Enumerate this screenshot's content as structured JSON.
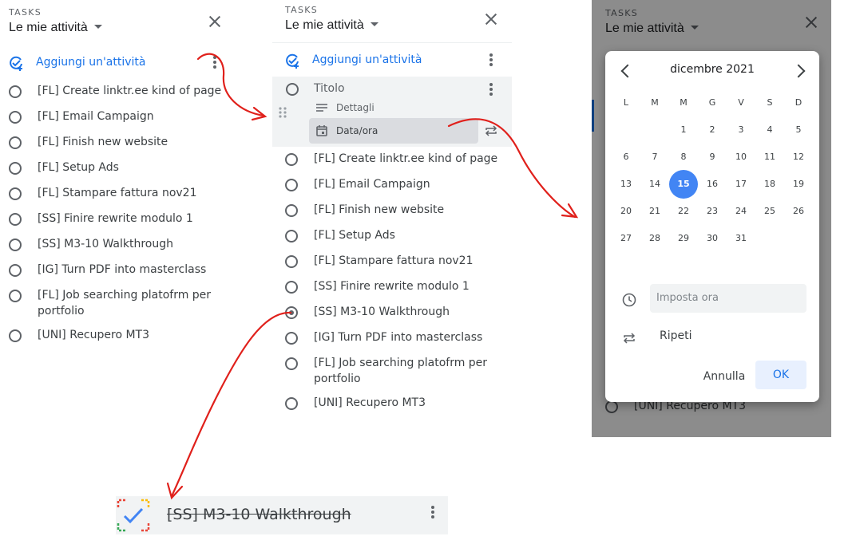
{
  "panel1": {
    "kicker": "TASKS",
    "title": "Le mie attività",
    "add_label": "Aggiungi un'attività",
    "tasks": [
      "[FL] Create linktr.ee kind of page",
      "[FL] Email Campaign",
      "[FL] Finish new website",
      "[FL] Setup Ads",
      "[FL] Stampare fattura nov21",
      "[SS] Finire rewrite modulo 1",
      "[SS] M3-10 Walkthrough",
      "[IG] Turn PDF into masterclass",
      "[FL] Job searching platofrm per",
      "portfolio",
      "[UNI] Recupero MT3"
    ]
  },
  "panel2": {
    "kicker": "TASKS",
    "title": "Le mie attività",
    "add_label": "Aggiungi un'attività",
    "editor": {
      "title_placeholder": "Titolo",
      "details_placeholder": "Dettagli",
      "date_label": "Data/ora"
    },
    "tasks": [
      "[FL] Create linktr.ee kind of page",
      "[FL] Email Campaign",
      "[FL] Finish new website",
      "[FL] Setup Ads",
      "[FL] Stampare fattura nov21",
      "[SS] Finire rewrite modulo 1",
      "[SS] M3-10 Walkthrough",
      "[IG] Turn PDF into masterclass",
      "[FL] Job searching platofrm per",
      "portfolio",
      "[UNI] Recupero MT3"
    ]
  },
  "panel3": {
    "kicker": "TASKS",
    "title": "Le mie attività",
    "bg_task": "[UNI] Recupero MT3",
    "calendar": {
      "month": "dicembre 2021",
      "weekdays": [
        "L",
        "M",
        "M",
        "G",
        "V",
        "S",
        "D"
      ],
      "weeks": [
        [
          "",
          "",
          "1",
          "2",
          "3",
          "4",
          "5"
        ],
        [
          "6",
          "7",
          "8",
          "9",
          "10",
          "11",
          "12"
        ],
        [
          "13",
          "14",
          "15",
          "16",
          "17",
          "18",
          "19"
        ],
        [
          "20",
          "21",
          "22",
          "23",
          "24",
          "25",
          "26"
        ],
        [
          "27",
          "28",
          "29",
          "30",
          "31",
          "",
          ""
        ]
      ],
      "selected_day": "15",
      "time_placeholder": "Imposta ora",
      "repeat_label": "Ripeti",
      "cancel_label": "Annulla",
      "ok_label": "OK"
    }
  },
  "completed": {
    "text": "[SS] M3-10 Walkthrough"
  },
  "colors": {
    "accent": "#1a73e8",
    "selected_day": "#4285f4",
    "arrow": "#e0201b"
  }
}
